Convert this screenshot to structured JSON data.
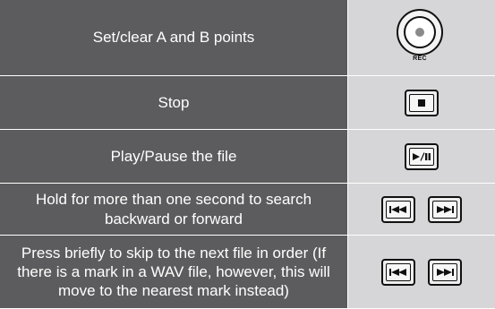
{
  "rows": [
    {
      "description": "Set/clear A and B points",
      "button": "rec",
      "button_label": "REC"
    },
    {
      "description": "Stop",
      "button": "stop"
    },
    {
      "description": "Play/Pause the file",
      "button": "play-pause"
    },
    {
      "description": "Hold for more than one second to search backward or forward",
      "button": "skip-pair"
    },
    {
      "description": "Press briefly to skip to the next file in order (If there is a mark in a WAV file, however, this will move to the nearest mark instead)",
      "button": "skip-pair"
    }
  ],
  "icons": {
    "rec": "rec-icon",
    "stop": "stop-icon",
    "play_pause": "play-pause-icon",
    "skip_back": "skip-back-icon",
    "skip_forward": "skip-forward-icon"
  },
  "colors": {
    "label_background": "#5c5c5e",
    "label_text": "#ffffff",
    "button_column_background": "#d6d6d8"
  }
}
